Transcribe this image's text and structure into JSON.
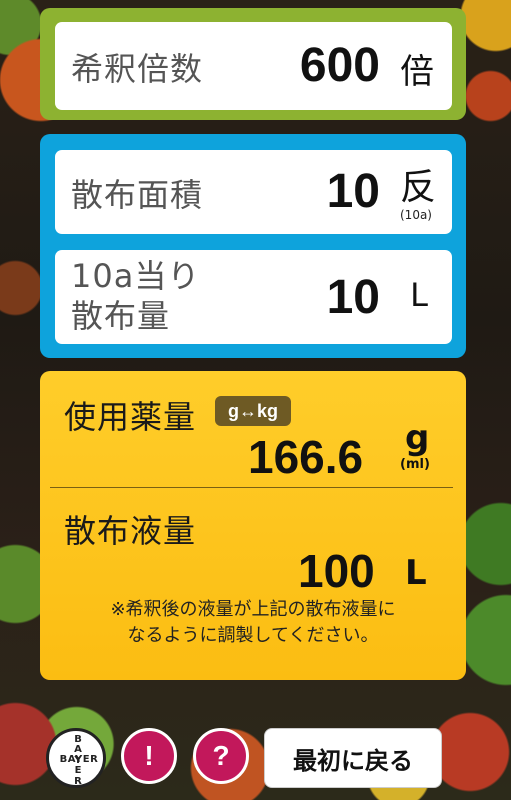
{
  "dilution": {
    "label": "希釈倍数",
    "value": "600",
    "unit": "倍"
  },
  "area": {
    "label": "散布面積",
    "value": "10",
    "unit": "反",
    "subunit": "(10a)"
  },
  "per_area": {
    "label_line1": "10a当り",
    "label_line2": "散布量",
    "value": "10",
    "unit": "L"
  },
  "chemical": {
    "label": "使用薬量",
    "toggle": "g↔kg",
    "value": "166.6",
    "unit": "g",
    "subunit": "(ml)"
  },
  "spray": {
    "label": "散布液量",
    "value": "100",
    "unit": "L"
  },
  "note": {
    "line1": "※希釈後の液量が上記の散布液量に",
    "line2": "なるように調製してください。"
  },
  "footer": {
    "logo_vertical": [
      "B",
      "A",
      "Y",
      "E",
      "R"
    ],
    "logo_horizontal": "BAYER",
    "info_label": "!",
    "help_label": "?",
    "reset_label": "最初に戻る"
  },
  "colors": {
    "green_panel": "#8db231",
    "blue_panel": "#0ea3dc",
    "yellow_panel": "#fbbd12",
    "action_button": "#c2185b"
  }
}
